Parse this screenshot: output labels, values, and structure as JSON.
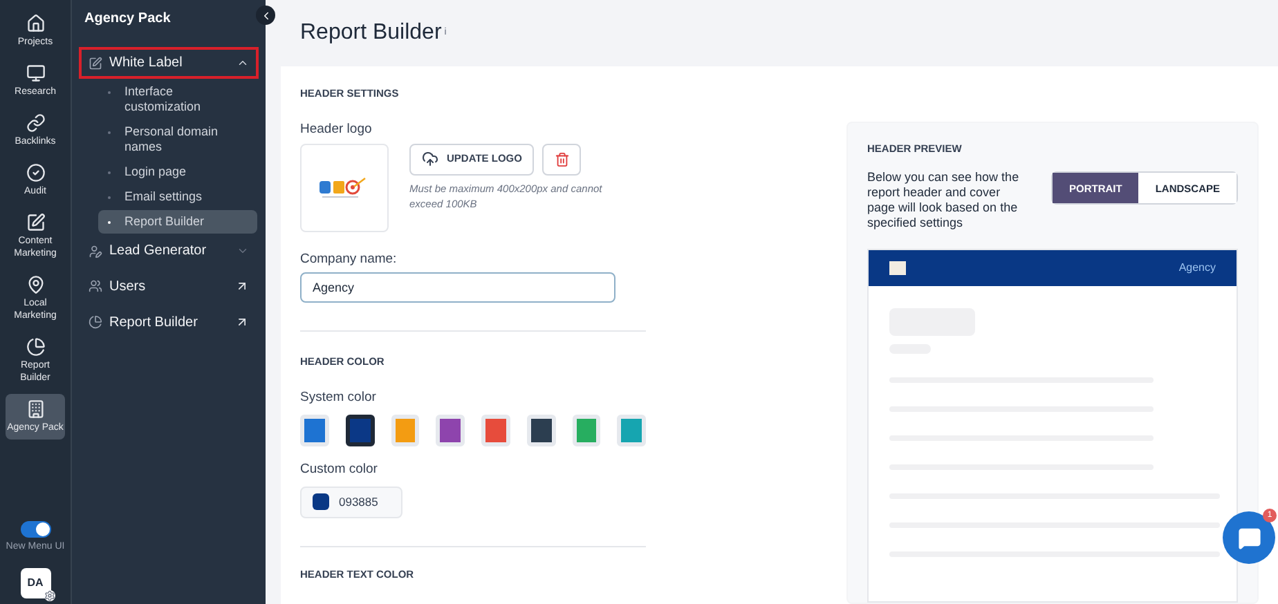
{
  "rail": {
    "items": [
      {
        "label": "Projects",
        "selected": false
      },
      {
        "label": "Research",
        "selected": false
      },
      {
        "label": "Backlinks",
        "selected": false
      },
      {
        "label": "Audit",
        "selected": false
      },
      {
        "label": "Content Marketing",
        "selected": false
      },
      {
        "label": "Local Marketing",
        "selected": false
      },
      {
        "label": "Report Builder",
        "selected": false
      },
      {
        "label": "Agency Pack",
        "selected": true
      }
    ],
    "toggle": {
      "label": "New Menu UI",
      "on": true
    },
    "avatar": "DA"
  },
  "sidebar": {
    "title": "Agency Pack",
    "items": [
      {
        "kind": "group",
        "label": "White Label",
        "expanded": true,
        "highlighted": true,
        "children": [
          {
            "label": "Interface customization",
            "selected": false
          },
          {
            "label": "Personal domain names",
            "selected": false
          },
          {
            "label": "Login page",
            "selected": false
          },
          {
            "label": "Email settings",
            "selected": false
          },
          {
            "label": "Report Builder",
            "selected": true
          }
        ]
      },
      {
        "kind": "group",
        "label": "Lead Generator",
        "expanded": false,
        "highlighted": false
      },
      {
        "kind": "link",
        "label": "Users"
      },
      {
        "kind": "link",
        "label": "Report Builder"
      }
    ]
  },
  "page": {
    "title": "Report Builder",
    "title_mark": "i"
  },
  "header_settings": {
    "heading": "HEADER SETTINGS",
    "logo_label": "Header logo",
    "update_button": "UPDATE LOGO",
    "hint": "Must be maximum 400x200px and cannot exceed 100KB",
    "company_label": "Company name:",
    "company_value": "Agency"
  },
  "header_color": {
    "heading": "HEADER COLOR",
    "system_label": "System color",
    "colors": [
      {
        "color": "#1e73d2",
        "selected": false
      },
      {
        "color": "#0b3886",
        "selected": true
      },
      {
        "color": "#f39c12",
        "selected": false
      },
      {
        "color": "#8e44ad",
        "selected": false
      },
      {
        "color": "#e74c3c",
        "selected": false
      },
      {
        "color": "#2c3e50",
        "selected": false
      },
      {
        "color": "#27ae60",
        "selected": false
      },
      {
        "color": "#16a5b0",
        "selected": false
      }
    ],
    "custom_label": "Custom color",
    "custom_value": "093885"
  },
  "header_text_color": {
    "heading": "HEADER TEXT COLOR"
  },
  "preview": {
    "heading": "HEADER PREVIEW",
    "description": "Below you can see how the report header and cover page will look based on the specified settings",
    "orientations": [
      {
        "label": "PORTRAIT",
        "selected": true
      },
      {
        "label": "LANDSCAPE",
        "selected": false
      }
    ],
    "company": "Agency"
  },
  "chat": {
    "badge": "1"
  }
}
